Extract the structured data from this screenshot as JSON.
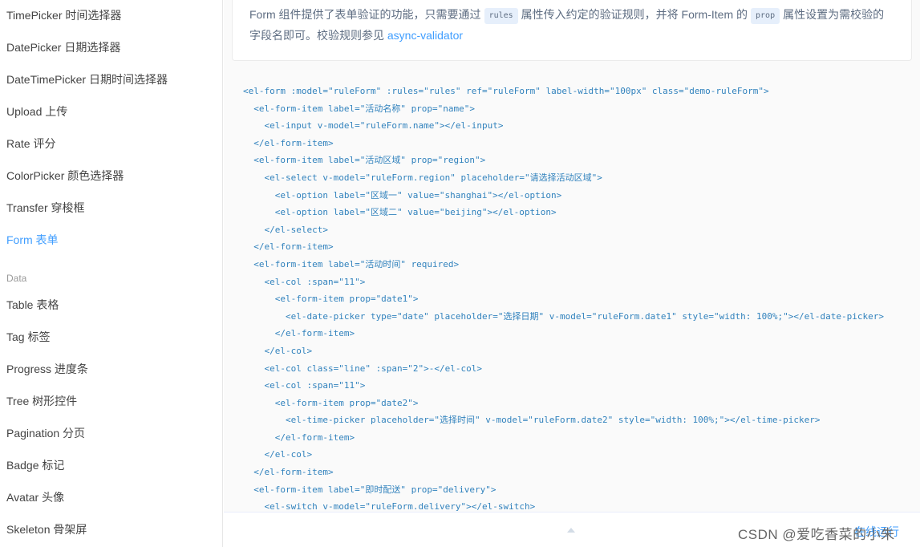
{
  "sidebar": {
    "items": [
      {
        "label": "TimePicker 时间选择器",
        "active": false
      },
      {
        "label": "DatePicker 日期选择器",
        "active": false
      },
      {
        "label": "DateTimePicker 日期时间选择器",
        "active": false
      },
      {
        "label": "Upload 上传",
        "active": false
      },
      {
        "label": "Rate 评分",
        "active": false
      },
      {
        "label": "ColorPicker 颜色选择器",
        "active": false
      },
      {
        "label": "Transfer 穿梭框",
        "active": false
      },
      {
        "label": "Form 表单",
        "active": true
      }
    ],
    "group_label": "Data",
    "data_items": [
      {
        "label": "Table 表格"
      },
      {
        "label": "Tag 标签"
      },
      {
        "label": "Progress 进度条"
      },
      {
        "label": "Tree 树形控件"
      },
      {
        "label": "Pagination 分页"
      },
      {
        "label": "Badge 标记"
      },
      {
        "label": "Avatar 头像"
      },
      {
        "label": "Skeleton 骨架屏"
      }
    ]
  },
  "description": {
    "part1": "Form 组件提供了表单验证的功能，只需要通过",
    "code1": "rules",
    "part2": "属性传入约定的验证规则，并将 Form-Item 的",
    "code2": "prop",
    "part3": "属性设置为需校验的字段名即可。校验规则参见",
    "link": "async-validator"
  },
  "code_lines": [
    "<el-form :model=\"ruleForm\" :rules=\"rules\" ref=\"ruleForm\" label-width=\"100px\" class=\"demo-ruleForm\">",
    "  <el-form-item label=\"活动名称\" prop=\"name\">",
    "    <el-input v-model=\"ruleForm.name\"></el-input>",
    "  </el-form-item>",
    "  <el-form-item label=\"活动区域\" prop=\"region\">",
    "    <el-select v-model=\"ruleForm.region\" placeholder=\"请选择活动区域\">",
    "      <el-option label=\"区域一\" value=\"shanghai\"></el-option>",
    "      <el-option label=\"区域二\" value=\"beijing\"></el-option>",
    "    </el-select>",
    "  </el-form-item>",
    "  <el-form-item label=\"活动时间\" required>",
    "    <el-col :span=\"11\">",
    "      <el-form-item prop=\"date1\">",
    "        <el-date-picker type=\"date\" placeholder=\"选择日期\" v-model=\"ruleForm.date1\" style=\"width: 100%;\"></el-date-picker>",
    "      </el-form-item>",
    "    </el-col>",
    "    <el-col class=\"line\" :span=\"2\">-</el-col>",
    "    <el-col :span=\"11\">",
    "      <el-form-item prop=\"date2\">",
    "        <el-time-picker placeholder=\"选择时间\" v-model=\"ruleForm.date2\" style=\"width: 100%;\"></el-time-picker>",
    "      </el-form-item>",
    "    </el-col>",
    "  </el-form-item>",
    "  <el-form-item label=\"即时配送\" prop=\"delivery\">",
    "    <el-switch v-model=\"ruleForm.delivery\"></el-switch>"
  ],
  "footer": {
    "online_label": "在线运行",
    "caret_icon": "caret-up-icon"
  },
  "watermark": "CSDN @爱吃香菜的小朱",
  "colors": {
    "accent": "#409eff",
    "code": "#3182bd"
  }
}
